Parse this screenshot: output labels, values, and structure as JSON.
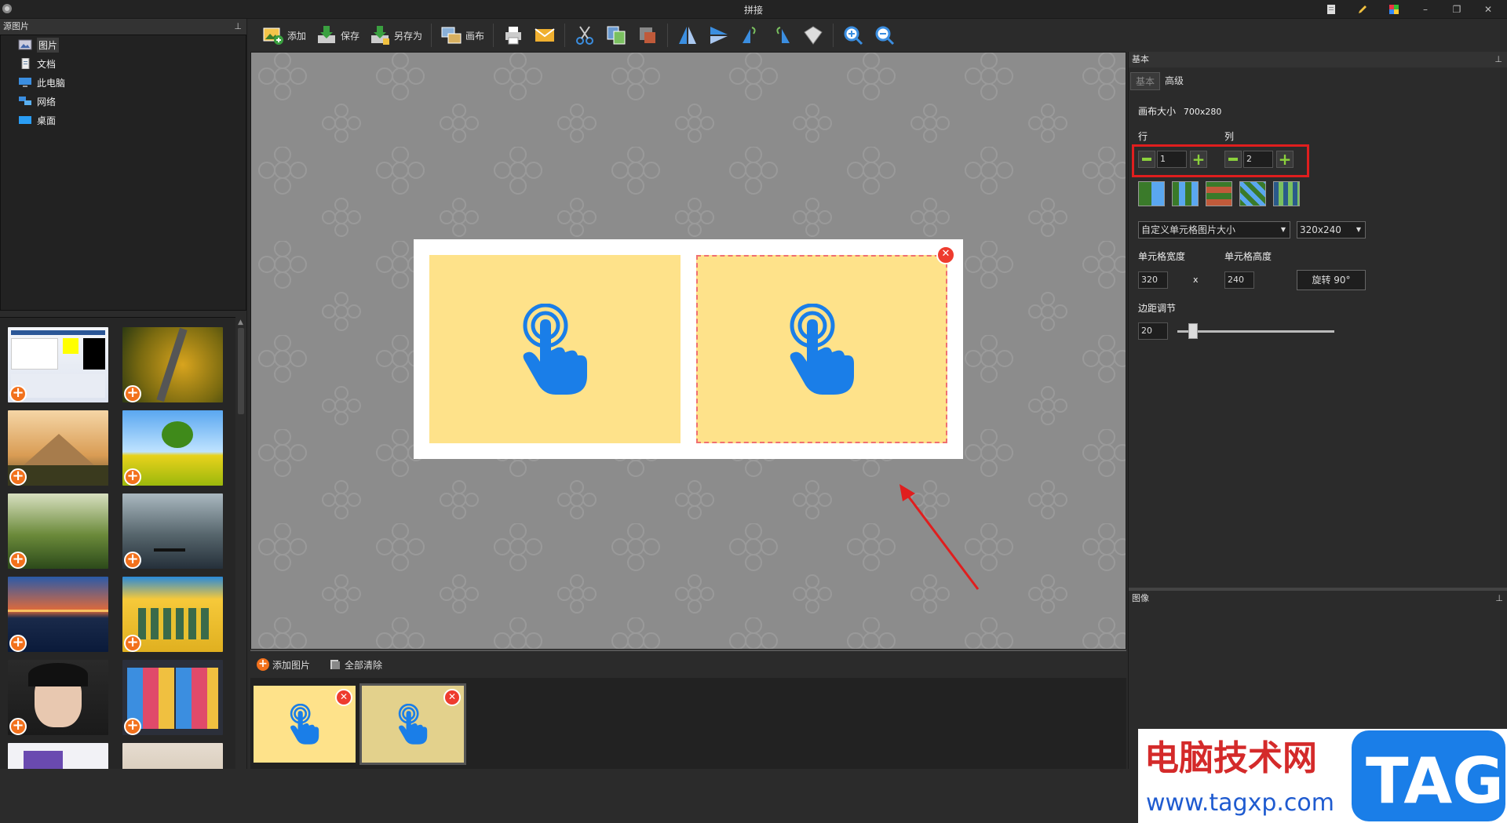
{
  "window": {
    "title": "拼接",
    "controls": [
      "–",
      "❐",
      "✕"
    ]
  },
  "left": {
    "header": "源图片",
    "tree": [
      {
        "label": "图片",
        "icon": "pictures-icon",
        "selected": true
      },
      {
        "label": "文档",
        "icon": "document-icon",
        "selected": false
      },
      {
        "label": "此电脑",
        "icon": "computer-icon",
        "selected": false
      },
      {
        "label": "网络",
        "icon": "network-icon",
        "selected": false
      },
      {
        "label": "桌面",
        "icon": "desktop-icon",
        "selected": false
      }
    ]
  },
  "toolbar": {
    "add": "添加",
    "save": "保存",
    "save_as": "另存为",
    "canvas": "画布"
  },
  "strip": {
    "add_label": "添加图片",
    "clear_label": "全部清除"
  },
  "right": {
    "section_title": "基本",
    "tabs": [
      "基本",
      "高级"
    ],
    "canvas_size_label": "画布大小",
    "canvas_size_value": "700x280",
    "rows_label": "行",
    "cols_label": "列",
    "rows_value": "1",
    "cols_value": "2",
    "cell_size_mode": "自定义单元格图片大小",
    "cell_size_preset": "320x240",
    "cell_width_label": "单元格宽度",
    "cell_height_label": "单元格高度",
    "cell_width": "320",
    "cell_height": "240",
    "times": "x",
    "rotate_label": "旋转  90°",
    "margin_label": "边距调节",
    "margin_value": "20",
    "margin_slider_fraction": 0.1,
    "image_section_title": "图像"
  },
  "watermark": {
    "cn": "电脑技术网",
    "url": "www.tagxp.com",
    "tag": "TAG"
  },
  "colors": {
    "accent_orange": "#f2711c",
    "close_red": "#ee3b2e",
    "cell_yellow": "#fee28a",
    "hand_blue": "#1a7ee8",
    "highlight_red": "#e01e1e",
    "stepper_green": "#8bd13c"
  }
}
